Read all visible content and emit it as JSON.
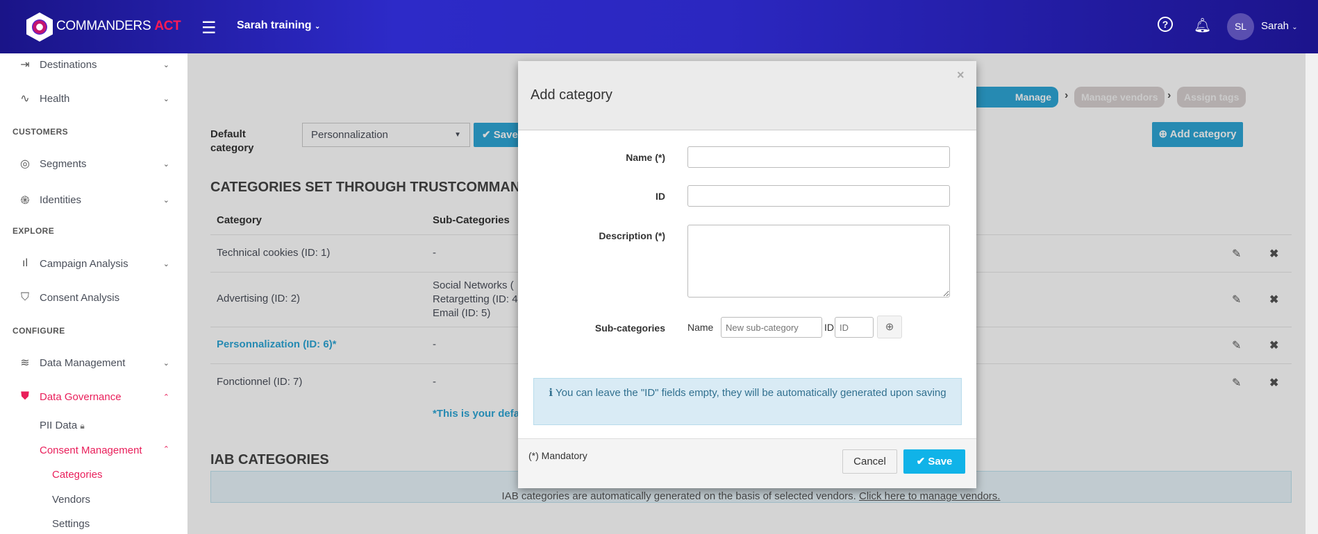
{
  "header": {
    "brand_main": "COMMANDERS",
    "brand_accent": "ACT",
    "workspace": "Sarah training",
    "avatar_initials": "SL",
    "user_name": "Sarah"
  },
  "sidebar": {
    "items": [
      {
        "label": "Destinations",
        "icon": "destinations-icon"
      },
      {
        "label": "Health",
        "icon": "pulse-icon"
      },
      {
        "label": "Segments",
        "icon": "target-icon"
      },
      {
        "label": "Identities",
        "icon": "fingerprint-icon"
      },
      {
        "label": "Campaign Analysis",
        "icon": "bar-chart-icon"
      },
      {
        "label": "Consent Analysis",
        "icon": "shield-check-icon"
      },
      {
        "label": "Data Management",
        "icon": "layers-icon"
      },
      {
        "label": "Data Governance",
        "icon": "shield-icon"
      }
    ],
    "sections": [
      "CUSTOMERS",
      "EXPLORE",
      "CONFIGURE"
    ],
    "sub_items": [
      "PII Data",
      "Consent Management"
    ],
    "sub_sub_items": [
      "Categories",
      "Vendors",
      "Settings"
    ]
  },
  "main": {
    "steps": [
      "Manage categories",
      "Manage vendors",
      "Assign tags"
    ],
    "add_category": "Add category",
    "default_label": "Default category",
    "default_value": "Personnalization",
    "save": "Save",
    "section_title": "CATEGORIES SET THROUGH TRUSTCOMMANDER",
    "columns": [
      "Category",
      "Sub-Categories"
    ],
    "rows": [
      {
        "category": "Technical cookies (ID: 1)",
        "subs": [
          "-"
        ]
      },
      {
        "category": "Advertising (ID: 2)",
        "subs": [
          "Social Networks (",
          "Retargetting (ID: 4",
          "Email (ID: 5)"
        ]
      },
      {
        "category": "Personnalization (ID: 6)*",
        "subs": [
          "-"
        ]
      },
      {
        "category": "Fonctionnel (ID: 7)",
        "subs": [
          "-"
        ]
      }
    ],
    "default_note": "*This is your defa",
    "iab_title": "IAB CATEGORIES",
    "iab_text": "IAB categories are automatically generated on the basis of selected vendors.",
    "iab_link": "Click here to manage vendors."
  },
  "modal": {
    "title": "Add category",
    "close": "×",
    "name_label": "Name (*)",
    "id_label": "ID",
    "description_label": "Description (*)",
    "subcategories_label": "Sub-categories",
    "sub_name_label": "Name",
    "sub_name_placeholder": "New sub-category",
    "sub_id_label": "ID",
    "sub_id_placeholder": "ID",
    "info": "You can leave the \"ID\" fields empty, they will be automatically generated upon saving",
    "mandatory": "(*) Mandatory",
    "cancel": "Cancel",
    "save": "Save"
  },
  "colors": {
    "accent": "#2ea6d6",
    "brand_red": "#e91e5a",
    "save_blue": "#10b3e8"
  }
}
